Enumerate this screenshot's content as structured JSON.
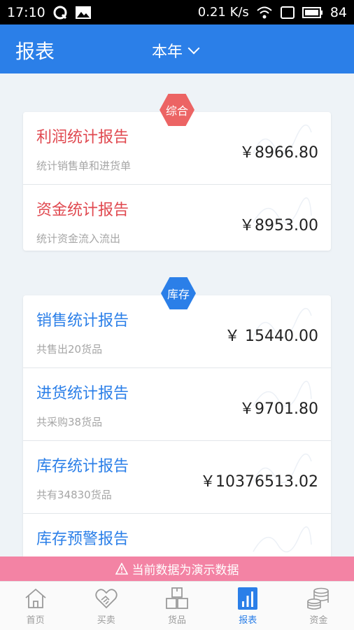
{
  "status_bar": {
    "time": "17:10",
    "speed": "0.21 K/s",
    "battery": "84"
  },
  "header": {
    "title": "报表",
    "period": "本年"
  },
  "sections": [
    {
      "badge": "综合",
      "items": [
        {
          "title": "利润统计报告",
          "subtitle": "统计销售单和进货单",
          "amount": "￥8966.80"
        },
        {
          "title": "资金统计报告",
          "subtitle": "统计资金流入流出",
          "amount": "￥8953.00"
        }
      ]
    },
    {
      "badge": "库存",
      "items": [
        {
          "title": "销售统计报告",
          "subtitle": "共售出20货品",
          "amount": "￥ 15440.00"
        },
        {
          "title": "进货统计报告",
          "subtitle": "共采购38货品",
          "amount": "￥9701.80"
        },
        {
          "title": "库存统计报告",
          "subtitle": "共有34830货品",
          "amount": "￥10376513.02"
        },
        {
          "title": "库存预警报告",
          "subtitle": "",
          "amount": ""
        }
      ]
    }
  ],
  "banner": {
    "icon": "warning-icon",
    "text": "当前数据为演示数据"
  },
  "tabs": [
    {
      "label": "首页",
      "icon": "home-icon",
      "active": false
    },
    {
      "label": "买卖",
      "icon": "handshake-icon",
      "active": false
    },
    {
      "label": "货品",
      "icon": "boxes-icon",
      "active": false
    },
    {
      "label": "报表",
      "icon": "bar-chart-icon",
      "active": true
    },
    {
      "label": "资金",
      "icon": "coins-icon",
      "active": false
    }
  ],
  "colors": {
    "primary": "#2b7fe8",
    "red": "#e0484f",
    "banner": "#f383a4"
  }
}
